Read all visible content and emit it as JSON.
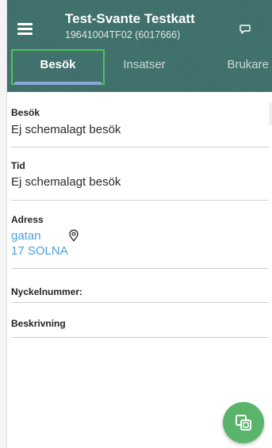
{
  "header": {
    "title": "Test-Svante Testkatt",
    "subtitle": "19641004TF02 (6017666)"
  },
  "tabs": [
    {
      "label": "Besök",
      "active": true
    },
    {
      "label": "Insatser",
      "active": false
    },
    {
      "label": "Brukare",
      "active": false
    }
  ],
  "visit": {
    "besok_label": "Besök",
    "besok_value": "Ej schemalagt besök",
    "tid_label": "Tid",
    "tid_value": "Ej schemalagt besök",
    "adress_label": "Adress",
    "adress_street": "gatan",
    "adress_postal": "17 SOLNA",
    "nyckel_label": "Nyckelnummer:",
    "beskrivning_label": "Beskrivning",
    "beskrivning_value": ""
  },
  "icons": {
    "menu": "menu-icon",
    "chat": "chat-icon",
    "location": "location-pin-icon",
    "fab": "copy-icon"
  },
  "colors": {
    "appbar": "#3e6f6b",
    "tab_highlight": "#4fc35a",
    "tab_indicator": "#89a7d9",
    "link": "#4aa1e0",
    "fab": "#5ab56a"
  }
}
